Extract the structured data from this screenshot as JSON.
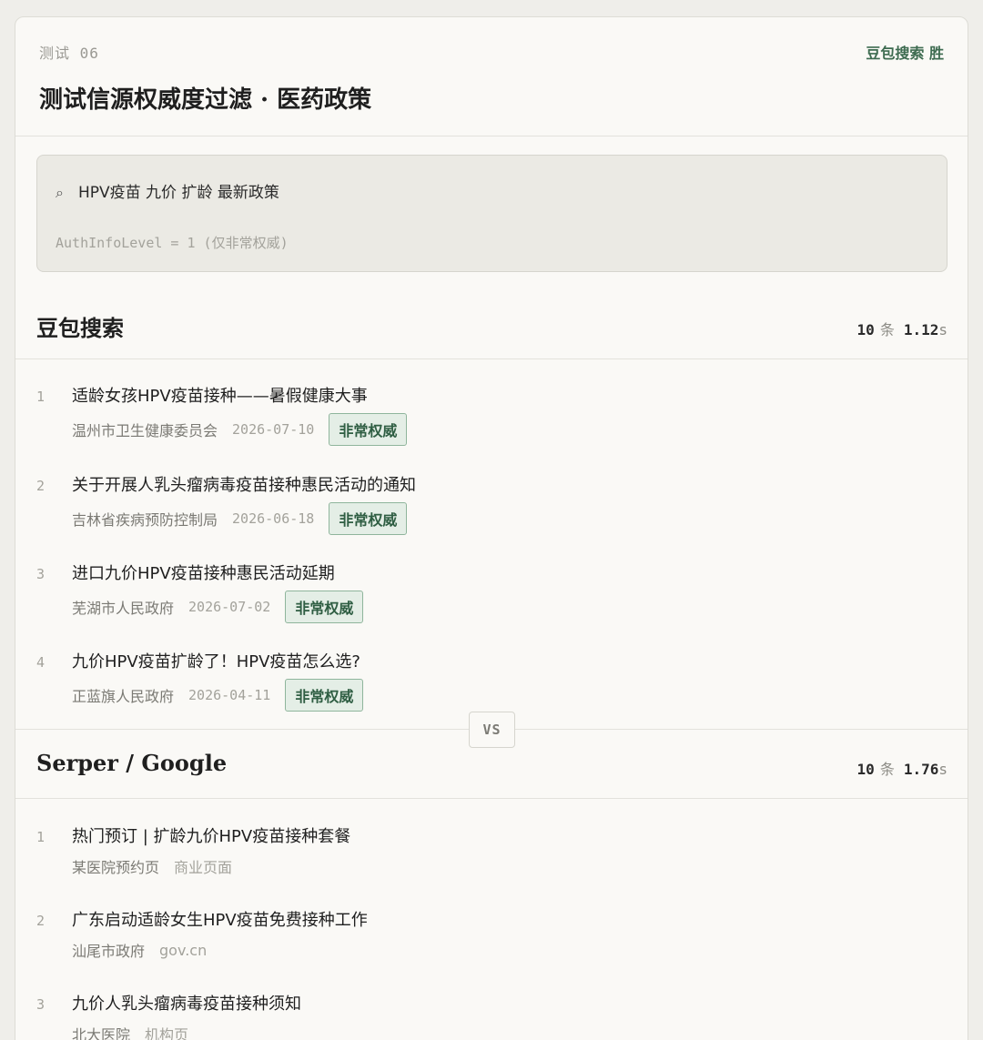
{
  "header": {
    "test_label": "测试 06",
    "winner": "豆包搜索 胜",
    "title": "测试信源权威度过滤 · 医药政策"
  },
  "query": {
    "icon": "search-icon",
    "text": "HPV疫苗 九价 扩龄 最新政策",
    "auth_info": "AuthInfoLevel = 1 (仅非常权威)"
  },
  "doubao": {
    "name": "豆包搜索",
    "count": "10",
    "count_unit": "条",
    "time": "1.12",
    "time_unit": "s",
    "results": [
      {
        "num": "1",
        "title": "适龄女孩HPV疫苗接种——暑假健康大事",
        "source": "温州市卫生健康委员会",
        "date": "2026-07-10",
        "tag": "非常权威"
      },
      {
        "num": "2",
        "title": "关于开展人乳头瘤病毒疫苗接种惠民活动的通知",
        "source": "吉林省疾病预防控制局",
        "date": "2026-06-18",
        "tag": "非常权威"
      },
      {
        "num": "3",
        "title": "进口九价HPV疫苗接种惠民活动延期",
        "source": "芜湖市人民政府",
        "date": "2026-07-02",
        "tag": "非常权威"
      },
      {
        "num": "4",
        "title": "九价HPV疫苗扩龄了！HPV疫苗怎么选?",
        "source": "正蓝旗人民政府",
        "date": "2026-04-11",
        "tag": "非常权威"
      }
    ]
  },
  "vs_label": "VS",
  "serper": {
    "name": "Serper / Google",
    "count": "10",
    "count_unit": "条",
    "time": "1.76",
    "time_unit": "s",
    "results": [
      {
        "num": "1",
        "title": "热门预订 | 扩龄九价HPV疫苗接种套餐",
        "source": "某医院预约页",
        "kind": "商业页面"
      },
      {
        "num": "2",
        "title": "广东启动适龄女生HPV疫苗免费接种工作",
        "source": "汕尾市政府",
        "kind": "gov.cn"
      },
      {
        "num": "3",
        "title": "九价人乳头瘤病毒疫苗接种须知",
        "source": "北大医院",
        "kind": "机构页"
      }
    ]
  },
  "colors": {
    "accent_green": "#3d6b50",
    "tag_bg": "#e4eee6",
    "tag_border": "#8fb59c",
    "card_bg": "#faf9f6",
    "page_bg": "#efeeea"
  }
}
